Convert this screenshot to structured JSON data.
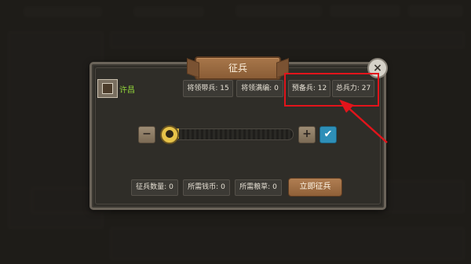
{
  "dialog": {
    "title": "征兵",
    "close_symbol": "×"
  },
  "general": {
    "name": "许昌",
    "icon": "general-portrait-icon"
  },
  "stats": {
    "carry_label": "将领带兵:",
    "carry_value": "15",
    "full_label": "将领满编:",
    "full_value": "0",
    "reserve_label": "预备兵:",
    "reserve_value": "12",
    "total_label": "总兵力:",
    "total_value": "27"
  },
  "slider": {
    "minus": "−",
    "plus": "+",
    "confirm": "✔",
    "level": 0
  },
  "bottom": {
    "recruit_label": "征兵数量:",
    "recruit_value": "0",
    "coin_label": "所需钱币:",
    "coin_value": "0",
    "grain_label": "所需粮草:",
    "grain_value": "0",
    "action_label": "立即征兵"
  },
  "colors": {
    "general_name": "#8fd03a",
    "highlight": "#e2141b",
    "confirm": "#2e8fb8"
  }
}
